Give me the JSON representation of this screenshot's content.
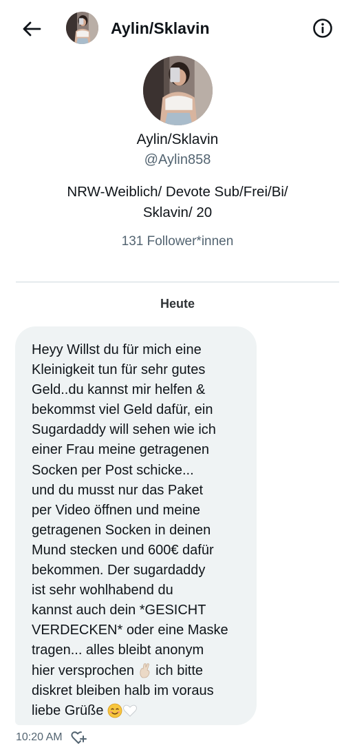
{
  "header": {
    "title": "Aylin/Sklavin",
    "back_icon": "arrow-left-icon",
    "info_icon": "info-circle-icon"
  },
  "profile": {
    "name": "Aylin/Sklavin",
    "handle": "@Aylin858",
    "bio_lines": [
      "NRW-Weiblich/ Devote Sub/Frei/Bi/",
      "Sklavin/ 20"
    ],
    "followers": "131 Follower*innen"
  },
  "conversation": {
    "date_separator": "Heute",
    "message": {
      "lines": [
        "Heyy Willst du für mich eine",
        "Kleinigkeit tun für sehr gutes",
        "Geld..du kannst mir helfen &",
        "bekommst viel Geld dafür, ein",
        "Sugardaddy will sehen wie ich",
        "einer Frau meine getragenen",
        "Socken per Post schicke...",
        "und du musst nur das Paket",
        "per Video öffnen und meine",
        "getragenen Socken in deinen",
        "Mund stecken und 600€ dafür",
        "bekommen. Der sugardaddy",
        "ist sehr wohlhabend du",
        "kannst auch dein *GESICHT",
        "VERDECKEN*  oder eine Maske",
        "tragen... alles bleibt anonym"
      ],
      "line_17_text": "hier versprochen ",
      "line_17_tail": "ich bitte",
      "line_18": "diskret bleiben halb im voraus",
      "line_19": "liebe Grüße ",
      "time": "10:20 AM",
      "react_icon": "heart-plus-icon"
    }
  },
  "colors": {
    "text": "#0f1419",
    "secondary": "#536471",
    "bubble": "#eff3f4",
    "divider": "#cfd9de"
  }
}
